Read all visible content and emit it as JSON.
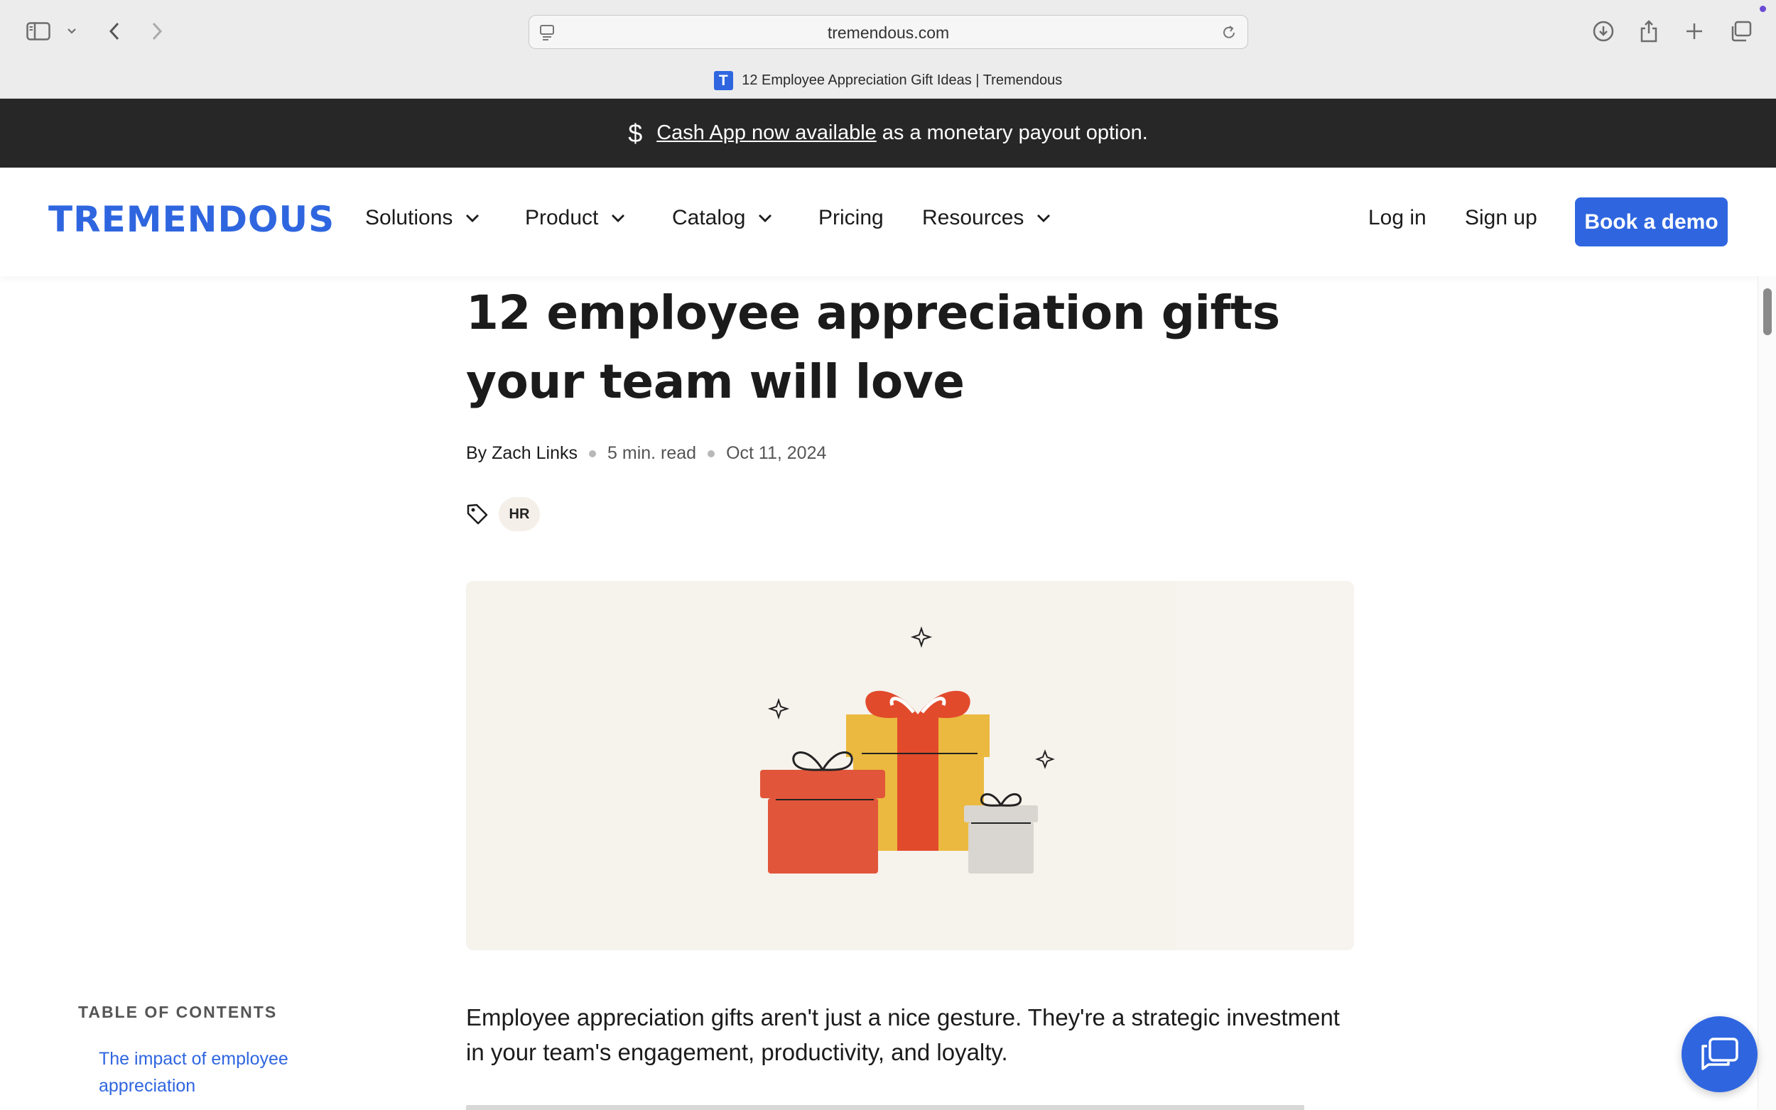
{
  "browser": {
    "url": "tremendous.com",
    "tab_title": "12 Employee Appreciation Gift Ideas | Tremendous",
    "favicon_letter": "T"
  },
  "announcement": {
    "icon": "dollar-icon",
    "link_text": "Cash App now available",
    "rest_text": "as a monetary payout option."
  },
  "nav": {
    "logo": "TREMENDOUS",
    "items": [
      {
        "label": "Solutions",
        "has_dropdown": true
      },
      {
        "label": "Product",
        "has_dropdown": true
      },
      {
        "label": "Catalog",
        "has_dropdown": true
      },
      {
        "label": "Pricing",
        "has_dropdown": false
      },
      {
        "label": "Resources",
        "has_dropdown": true
      }
    ],
    "login": "Log in",
    "signup": "Sign up",
    "cta": "Book a demo",
    "accent_color": "#2f66e0"
  },
  "article": {
    "title": "12 employee appreciation gifts your team will love",
    "author": "By Zach Links",
    "read_time": "5 min. read",
    "date": "Oct 11, 2024",
    "tag": "HR",
    "intro": "Employee appreciation gifts aren't just a nice gesture. They're a strategic investment in your team's engagement, productivity, and loyalty."
  },
  "toc": {
    "heading": "TABLE OF CONTENTS",
    "items": [
      "The impact of employee appreciation"
    ]
  },
  "chat": {
    "icon": "chat-bubbles-icon"
  }
}
